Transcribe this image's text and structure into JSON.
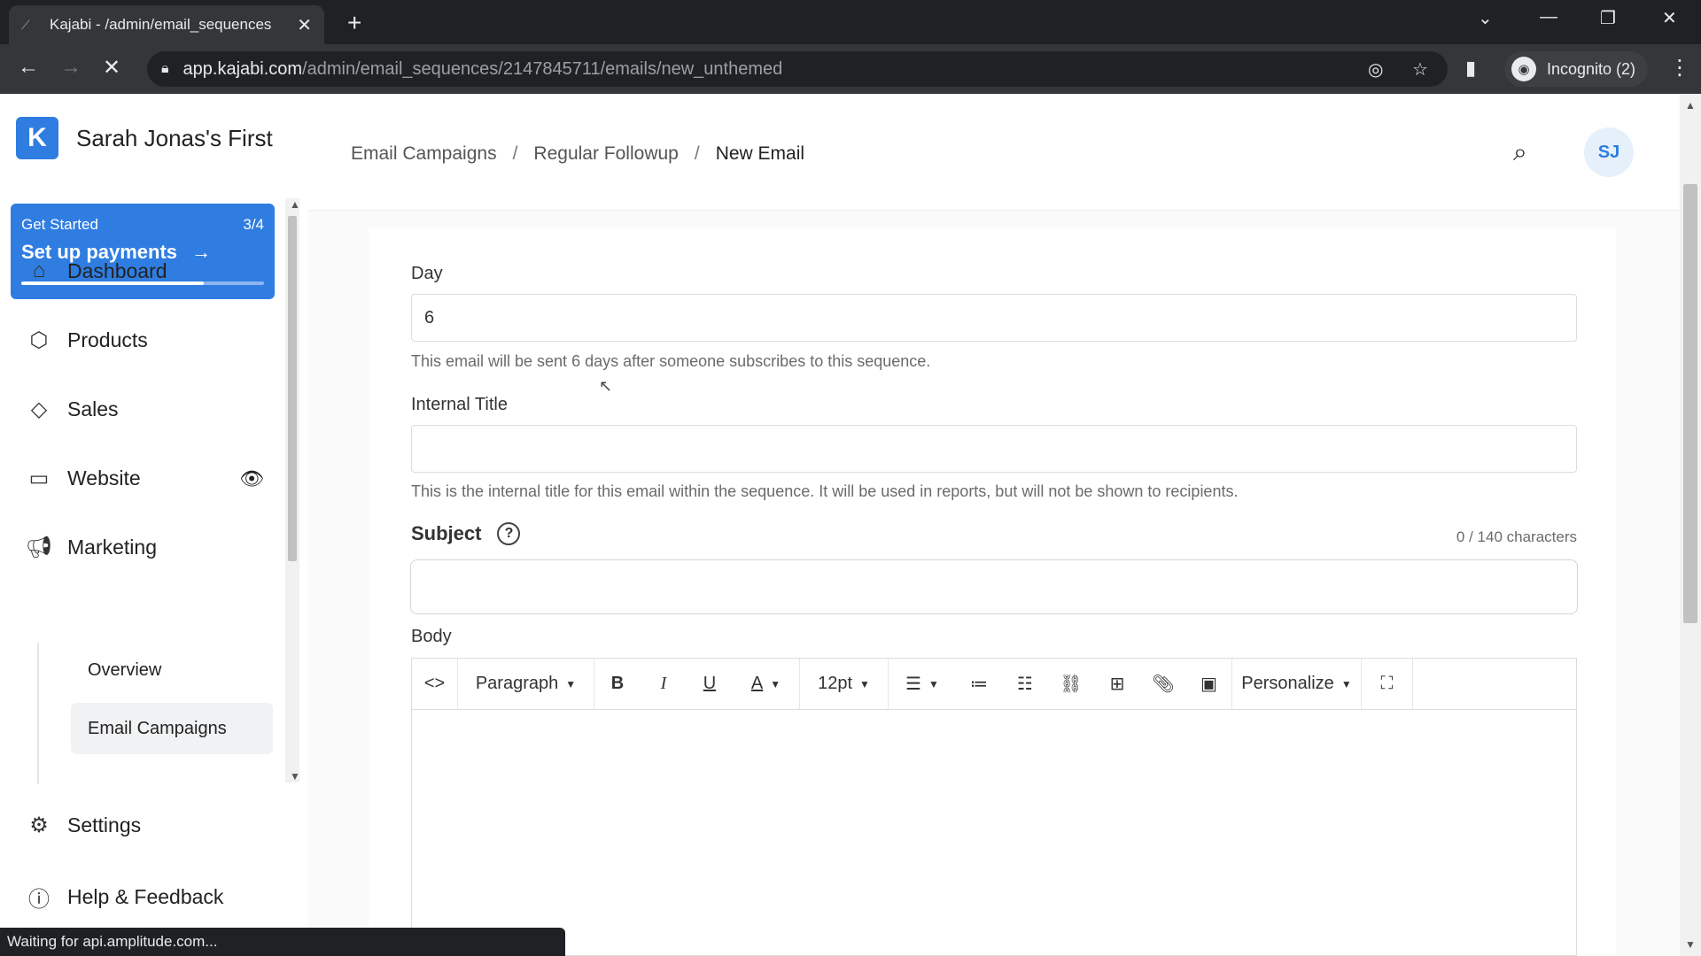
{
  "browser": {
    "tab_title": "Kajabi - /admin/email_sequences",
    "url_domain": "app.kajabi.com",
    "url_path": "/admin/email_sequences/2147845711/emails/new_unthemed",
    "profile_label": "Incognito (2)",
    "status_text": "Waiting for api.amplitude.com..."
  },
  "sidebar": {
    "brand_name": "Sarah Jonas's First",
    "get_started": {
      "label": "Get Started",
      "progress_text": "3/4",
      "progress_fraction": 0.75,
      "action": "Set up payments"
    },
    "nav": [
      {
        "label": "Dashboard",
        "icon": "home-icon"
      },
      {
        "label": "Products",
        "icon": "box-icon"
      },
      {
        "label": "Sales",
        "icon": "tag-icon"
      },
      {
        "label": "Website",
        "icon": "monitor-icon"
      },
      {
        "label": "Marketing",
        "icon": "megaphone-icon"
      }
    ],
    "marketing_sub": [
      {
        "label": "Overview"
      },
      {
        "label": "Email Campaigns"
      }
    ],
    "footer_nav": [
      {
        "label": "Settings",
        "icon": "gear-icon"
      },
      {
        "label": "Help & Feedback",
        "icon": "help-icon"
      }
    ]
  },
  "header": {
    "breadcrumbs": [
      "Email Campaigns",
      "Regular Followup",
      "New Email"
    ],
    "avatar_initials": "SJ"
  },
  "form": {
    "day_label": "Day",
    "day_value": "6",
    "day_help": "This email will be sent 6 days after someone subscribes to this sequence.",
    "internal_title_label": "Internal Title",
    "internal_title_value": "",
    "internal_title_help": "This is the internal title for this email within the sequence. It will be used in reports, but will not be shown to recipients.",
    "subject_label": "Subject",
    "subject_count": "0 / 140 characters",
    "body_label": "Body",
    "toolbar": {
      "paragraph": "Paragraph",
      "font_size": "12pt",
      "personalize": "Personalize"
    }
  },
  "colors": {
    "accent": "#2f7de1",
    "chrome_dark": "#202124"
  }
}
